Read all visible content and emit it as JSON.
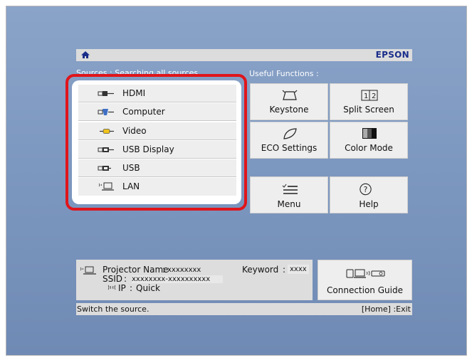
{
  "header": {
    "brand": "EPSON",
    "home_icon": "home-icon"
  },
  "sources_title": "Sources : Searching all sources...",
  "sources": [
    {
      "label": "HDMI",
      "icon": "hdmi-icon"
    },
    {
      "label": "Computer",
      "icon": "computer-icon"
    },
    {
      "label": "Video",
      "icon": "video-icon"
    },
    {
      "label": "USB Display",
      "icon": "usb-display-icon"
    },
    {
      "label": "USB",
      "icon": "usb-icon"
    },
    {
      "label": "LAN",
      "icon": "lan-icon"
    }
  ],
  "functions_title": "Useful Functions :",
  "functions": [
    {
      "label": "Keystone",
      "icon": "keystone-icon"
    },
    {
      "label": "Split Screen",
      "icon": "split-screen-icon"
    },
    {
      "label": "ECO Settings",
      "icon": "leaf-icon"
    },
    {
      "label": "Color Mode",
      "icon": "color-mode-icon"
    },
    {
      "label": "Menu",
      "icon": "menu-icon"
    },
    {
      "label": "Help",
      "icon": "help-icon"
    }
  ],
  "network": {
    "projector_name_label": "Projector Name",
    "projector_name_value": "xxxxxxxx",
    "ssid_label": "SSID",
    "ssid_value": "xxxxxxxx-xxxxxxxxxx",
    "ip_label": "IP",
    "ip_value": "Quick",
    "keyword_label": "Keyword",
    "keyword_value": "xxxx"
  },
  "connection_guide": {
    "label": "Connection Guide",
    "icon": "connection-guide-icon"
  },
  "status": {
    "hint": "Switch the source.",
    "exit_hint": "[Home] :Exit"
  },
  "colors": {
    "highlight": "#e0151b",
    "brand": "#1a2d8a",
    "background": "#7d98c0"
  }
}
